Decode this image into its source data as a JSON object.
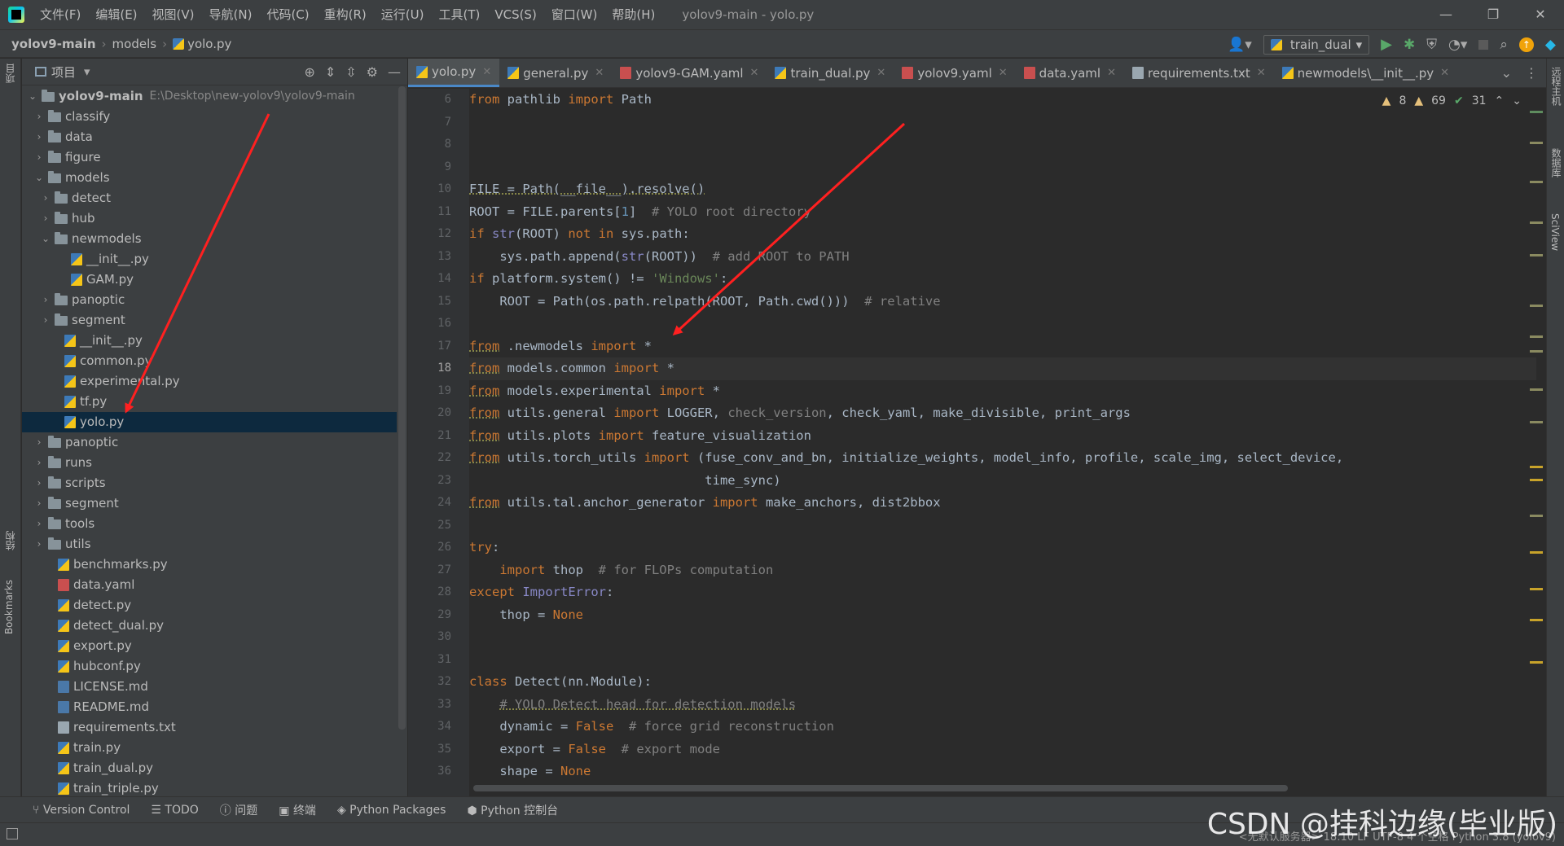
{
  "titlebar": {
    "menu": [
      "文件(F)",
      "编辑(E)",
      "视图(V)",
      "导航(N)",
      "代码(C)",
      "重构(R)",
      "运行(U)",
      "工具(T)",
      "VCS(S)",
      "窗口(W)",
      "帮助(H)"
    ],
    "window_title": "yolov9-main - yolo.py",
    "controls": [
      "—",
      "❐",
      "✕"
    ]
  },
  "breadcrumb": {
    "root": "yolov9-main",
    "folder": "models",
    "file": "yolo.py"
  },
  "run_config": "train_dual",
  "project": {
    "title": "项目",
    "root_name": "yolov9-main",
    "root_path": "E:\\Desktop\\new-yolov9\\yolov9-main",
    "items": [
      {
        "label": "classify",
        "type": "folder",
        "depth": 1,
        "open": false
      },
      {
        "label": "data",
        "type": "folder",
        "depth": 1,
        "open": false
      },
      {
        "label": "figure",
        "type": "folder",
        "depth": 1,
        "open": false
      },
      {
        "label": "models",
        "type": "folder",
        "depth": 1,
        "open": true
      },
      {
        "label": "detect",
        "type": "folder",
        "depth": 2,
        "open": false
      },
      {
        "label": "hub",
        "type": "folder",
        "depth": 2,
        "open": false
      },
      {
        "label": "newmodels",
        "type": "folder",
        "depth": 2,
        "open": true
      },
      {
        "label": "__init__.py",
        "type": "py",
        "depth": 3
      },
      {
        "label": "GAM.py",
        "type": "py",
        "depth": 3
      },
      {
        "label": "panoptic",
        "type": "folder",
        "depth": 2,
        "open": false
      },
      {
        "label": "segment",
        "type": "folder",
        "depth": 2,
        "open": false
      },
      {
        "label": "__init__.py",
        "type": "py",
        "depth": 2
      },
      {
        "label": "common.py",
        "type": "py",
        "depth": 2
      },
      {
        "label": "experimental.py",
        "type": "py",
        "depth": 2
      },
      {
        "label": "tf.py",
        "type": "py",
        "depth": 2
      },
      {
        "label": "yolo.py",
        "type": "py",
        "depth": 2,
        "selected": true
      },
      {
        "label": "panoptic",
        "type": "folder",
        "depth": 1,
        "open": false
      },
      {
        "label": "runs",
        "type": "folder",
        "depth": 1,
        "open": false
      },
      {
        "label": "scripts",
        "type": "folder",
        "depth": 1,
        "open": false
      },
      {
        "label": "segment",
        "type": "folder",
        "depth": 1,
        "open": false
      },
      {
        "label": "tools",
        "type": "folder",
        "depth": 1,
        "open": false
      },
      {
        "label": "utils",
        "type": "folder",
        "depth": 1,
        "open": false
      },
      {
        "label": "benchmarks.py",
        "type": "py",
        "depth": 1
      },
      {
        "label": "data.yaml",
        "type": "yml",
        "depth": 1
      },
      {
        "label": "detect.py",
        "type": "py",
        "depth": 1
      },
      {
        "label": "detect_dual.py",
        "type": "py",
        "depth": 1
      },
      {
        "label": "export.py",
        "type": "py",
        "depth": 1
      },
      {
        "label": "hubconf.py",
        "type": "py",
        "depth": 1
      },
      {
        "label": "LICENSE.md",
        "type": "md",
        "depth": 1
      },
      {
        "label": "README.md",
        "type": "md",
        "depth": 1
      },
      {
        "label": "requirements.txt",
        "type": "txt",
        "depth": 1
      },
      {
        "label": "train.py",
        "type": "py",
        "depth": 1
      },
      {
        "label": "train_dual.py",
        "type": "py",
        "depth": 1
      },
      {
        "label": "train_triple.py",
        "type": "py",
        "depth": 1
      }
    ]
  },
  "tabs": [
    {
      "label": "yolo.py",
      "type": "py",
      "active": true
    },
    {
      "label": "general.py",
      "type": "py"
    },
    {
      "label": "yolov9-GAM.yaml",
      "type": "yml"
    },
    {
      "label": "train_dual.py",
      "type": "py"
    },
    {
      "label": "yolov9.yaml",
      "type": "yml"
    },
    {
      "label": "data.yaml",
      "type": "yml"
    },
    {
      "label": "requirements.txt",
      "type": "txt"
    },
    {
      "label": "newmodels\\__init__.py",
      "type": "py"
    }
  ],
  "inspections": {
    "warnings_a": "8",
    "warnings_b": "69",
    "ok": "31"
  },
  "code": {
    "current_line": 18,
    "lines": [
      {
        "n": "6",
        "tokens": [
          [
            "kw",
            "from"
          ],
          [
            "",
            " pathlib "
          ],
          [
            "kw",
            "import"
          ],
          [
            "",
            " Path"
          ]
        ]
      },
      {
        "n": "7",
        "tokens": []
      },
      {
        "n": "8",
        "tokens": []
      },
      {
        "n": "9",
        "tokens": []
      },
      {
        "n": "10",
        "tokens": [
          [
            "ul",
            "FILE = Path(__file__).resolve()"
          ]
        ]
      },
      {
        "n": "11",
        "tokens": [
          [
            "",
            "ROOT = FILE.parents["
          ],
          [
            "num",
            "1"
          ],
          [
            "",
            "]  "
          ],
          [
            "cm",
            "# YOLO root directory"
          ]
        ]
      },
      {
        "n": "12",
        "tokens": [
          [
            "kw",
            "if "
          ],
          [
            "bi",
            "str"
          ],
          [
            "",
            "(ROOT) "
          ],
          [
            "kw",
            "not in"
          ],
          [
            "",
            " sys.path:"
          ]
        ]
      },
      {
        "n": "13",
        "tokens": [
          [
            "",
            "    sys.path.append("
          ],
          [
            "bi",
            "str"
          ],
          [
            "",
            "(ROOT))  "
          ],
          [
            "cm",
            "# add ROOT to PATH"
          ]
        ]
      },
      {
        "n": "14",
        "tokens": [
          [
            "kw",
            "if"
          ],
          [
            "",
            " platform.system() != "
          ],
          [
            "st",
            "'Windows'"
          ],
          [
            "",
            ":"
          ]
        ]
      },
      {
        "n": "15",
        "tokens": [
          [
            "",
            "    ROOT = Path(os.path.relpath(ROOT, Path.cwd()))  "
          ],
          [
            "cm",
            "# relative"
          ]
        ]
      },
      {
        "n": "16",
        "tokens": []
      },
      {
        "n": "17",
        "tokens": [
          [
            "kw ul",
            "from"
          ],
          [
            "",
            " .newmodels "
          ],
          [
            "kw",
            "import"
          ],
          [
            "",
            " *"
          ]
        ]
      },
      {
        "n": "18",
        "tokens": [
          [
            "kw ul",
            "from"
          ],
          [
            "",
            " models.common "
          ],
          [
            "kw",
            "import"
          ],
          [
            "",
            " *"
          ]
        ]
      },
      {
        "n": "19",
        "tokens": [
          [
            "kw ul",
            "from"
          ],
          [
            "",
            " models.experimental "
          ],
          [
            "kw",
            "import"
          ],
          [
            "",
            " *"
          ]
        ]
      },
      {
        "n": "20",
        "tokens": [
          [
            "kw ul",
            "from"
          ],
          [
            "",
            " utils.general "
          ],
          [
            "kw",
            "import"
          ],
          [
            "",
            " LOGGER, "
          ],
          [
            "gray",
            "check_version"
          ],
          [
            "",
            ", check_yaml, make_divisible, print_args"
          ]
        ]
      },
      {
        "n": "21",
        "tokens": [
          [
            "kw ul",
            "from"
          ],
          [
            "",
            " utils.plots "
          ],
          [
            "kw",
            "import"
          ],
          [
            "",
            " feature_visualization"
          ]
        ]
      },
      {
        "n": "22",
        "tokens": [
          [
            "kw ul",
            "from"
          ],
          [
            "",
            " utils.torch_utils "
          ],
          [
            "kw",
            "import"
          ],
          [
            "",
            " (fuse_conv_and_bn, initialize_weights, model_info, profile, scale_img, select_device,"
          ]
        ]
      },
      {
        "n": "23",
        "tokens": [
          [
            "",
            "                               time_sync)"
          ]
        ]
      },
      {
        "n": "24",
        "tokens": [
          [
            "kw ul",
            "from"
          ],
          [
            "",
            " utils.tal.anchor_generator "
          ],
          [
            "kw",
            "import"
          ],
          [
            "",
            " make_anchors, dist2bbox"
          ]
        ]
      },
      {
        "n": "25",
        "tokens": []
      },
      {
        "n": "26",
        "tokens": [
          [
            "kw",
            "try"
          ],
          [
            "",
            ":"
          ]
        ]
      },
      {
        "n": "27",
        "tokens": [
          [
            "",
            "    "
          ],
          [
            "kw",
            "import"
          ],
          [
            "",
            " thop  "
          ],
          [
            "cm",
            "# for FLOPs computation"
          ]
        ]
      },
      {
        "n": "28",
        "tokens": [
          [
            "kw",
            "except"
          ],
          [
            "",
            " "
          ],
          [
            "bi",
            "ImportError"
          ],
          [
            "",
            ":"
          ]
        ]
      },
      {
        "n": "29",
        "tokens": [
          [
            "",
            "    thop = "
          ],
          [
            "kw",
            "None"
          ]
        ]
      },
      {
        "n": "30",
        "tokens": []
      },
      {
        "n": "31",
        "tokens": []
      },
      {
        "n": "32",
        "tokens": [
          [
            "kw",
            "class"
          ],
          [
            "",
            " Detect(nn.Module):"
          ]
        ]
      },
      {
        "n": "33",
        "tokens": [
          [
            "",
            "    "
          ],
          [
            "cm ul",
            "# YOLO Detect head for detection models"
          ]
        ]
      },
      {
        "n": "34",
        "tokens": [
          [
            "",
            "    dynamic = "
          ],
          [
            "kw",
            "False"
          ],
          [
            "",
            "  "
          ],
          [
            "cm",
            "# force grid reconstruction"
          ]
        ]
      },
      {
        "n": "35",
        "tokens": [
          [
            "",
            "    export = "
          ],
          [
            "kw",
            "False"
          ],
          [
            "",
            "  "
          ],
          [
            "cm",
            "# export mode"
          ]
        ]
      },
      {
        "n": "36",
        "tokens": [
          [
            "",
            "    shape = "
          ],
          [
            "kw",
            "None"
          ]
        ]
      }
    ]
  },
  "bottom_tools": [
    "Version Control",
    "TODO",
    "问题",
    "终端",
    "Python Packages",
    "Python 控制台"
  ],
  "left_strip": {
    "project": "项目",
    "structure": "结构",
    "bookmarks": "Bookmarks"
  },
  "right_strip": {
    "remote": "远程主机",
    "database": "数据库",
    "sciview": "SciView"
  },
  "status": "<无默认服务器>   18:10   LF   UTF-8   4 个空格   Python 3.8 (yolov9)",
  "watermark": "CSDN @挂科边缘(毕业版)",
  "colors": {
    "accent": "#4a88c7",
    "arrow": "#ff2020",
    "selection": "#0d293e"
  }
}
